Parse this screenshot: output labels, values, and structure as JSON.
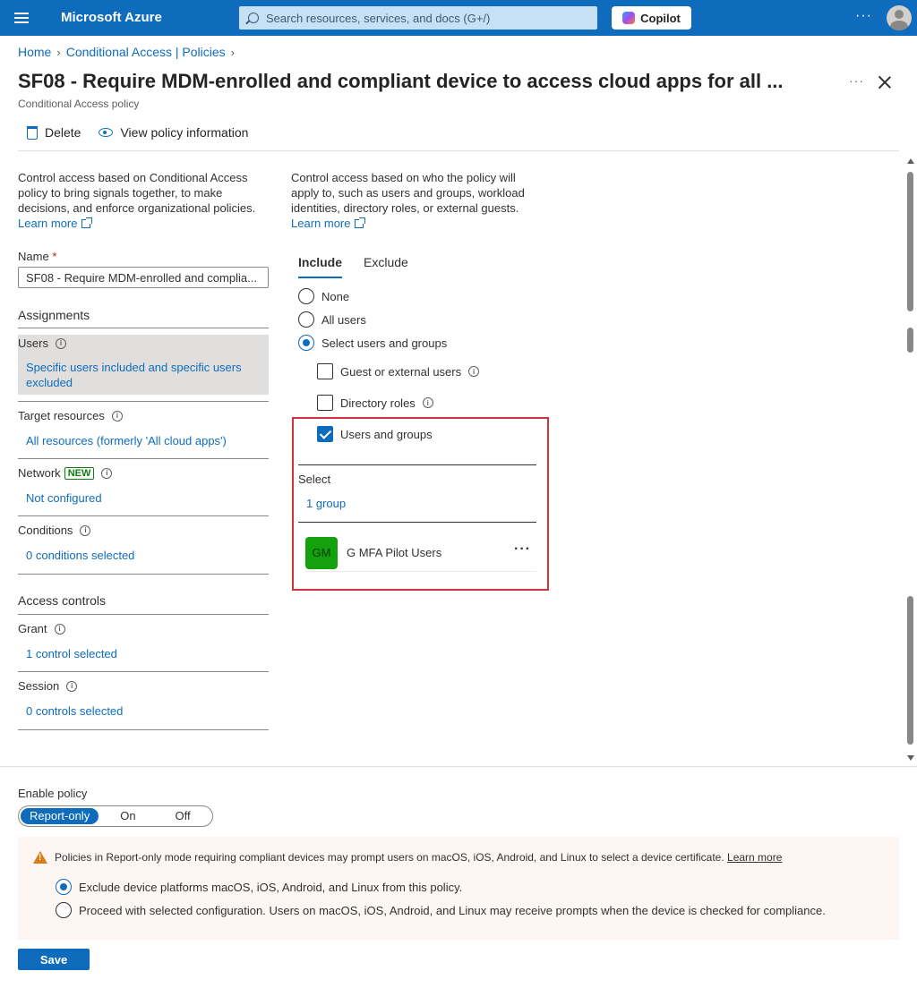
{
  "topbar": {
    "brand": "Microsoft Azure",
    "search_placeholder": "Search resources, services, and docs (G+/)",
    "copilot_label": "Copilot",
    "more": "···"
  },
  "breadcrumb": [
    "Home",
    "Conditional Access | Policies"
  ],
  "header": {
    "title": "SF08 - Require MDM-enrolled and compliant device to access cloud apps for all ...",
    "subtitle": "Conditional Access policy",
    "more": "···"
  },
  "toolbar": {
    "delete_label": "Delete",
    "view_info_label": "View policy information"
  },
  "left": {
    "intro": "Control access based on Conditional Access policy to bring signals together, to make decisions, and enforce organizational policies.",
    "learn_more": "Learn more",
    "name_label": "Name",
    "name_required": "*",
    "name_value": "SF08 - Require MDM-enrolled and complia...",
    "assignments": "Assignments",
    "users_label": "Users",
    "users_value": "Specific users included and specific users excluded",
    "target_label": "Target resources",
    "target_value": "All resources (formerly 'All cloud apps')",
    "network_label": "Network",
    "network_badge": "NEW",
    "network_value": "Not configured",
    "conditions_label": "Conditions",
    "conditions_value": "0 conditions selected",
    "access_controls": "Access controls",
    "grant_label": "Grant",
    "grant_value": "1 control selected",
    "session_label": "Session",
    "session_value": "0 controls selected"
  },
  "right": {
    "intro": "Control access based on who the policy will apply to, such as users and groups, workload identities, directory roles, or external guests.",
    "learn_more": "Learn more",
    "tabs": [
      "Include",
      "Exclude"
    ],
    "radios": [
      {
        "label": "None",
        "selected": false
      },
      {
        "label": "All users",
        "selected": false
      },
      {
        "label": "Select users and groups",
        "selected": true
      }
    ],
    "checks": [
      {
        "label": "Guest or external users",
        "checked": false
      },
      {
        "label": "Directory roles",
        "checked": false
      },
      {
        "label": "Users and groups",
        "checked": true
      }
    ],
    "select_heading": "Select",
    "select_link": "1 group",
    "member": {
      "initials": "GM",
      "name": "G MFA Pilot Users",
      "more": "···"
    }
  },
  "footer": {
    "enable_policy": "Enable policy",
    "options": [
      "Report-only",
      "On",
      "Off"
    ],
    "selected_option": "Report-only",
    "warning": "Policies in Report-only mode requiring compliant devices may prompt users on macOS, iOS, Android, and Linux to select a device certificate.",
    "warning_link": "Learn more",
    "choice_1": "Exclude device platforms macOS, iOS, Android, and Linux from this policy.",
    "choice_2": "Proceed with selected configuration. Users on macOS, iOS, Android, and Linux may receive prompts when the device is checked for compliance.",
    "save_label": "Save"
  },
  "colors": {
    "accent": "#0f6cbd",
    "highlight_border": "#d13438",
    "avatar_bg": "#13a10e",
    "warning": "#da7b14"
  }
}
